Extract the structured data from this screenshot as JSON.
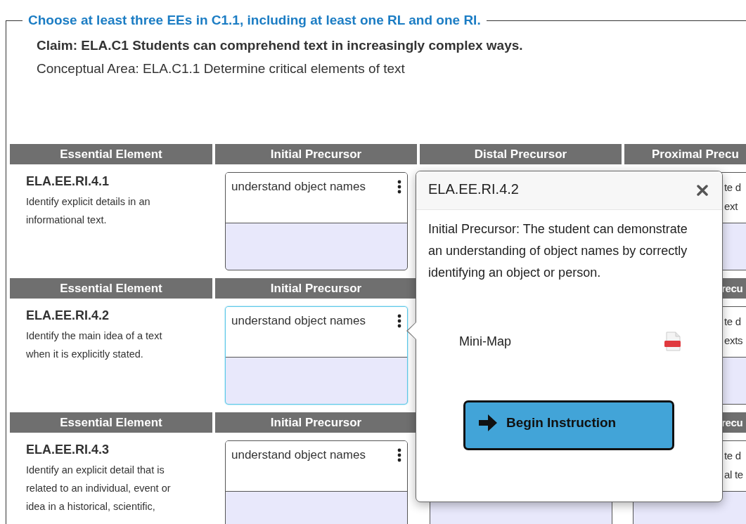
{
  "legend": "Choose at least three EEs in C1.1, including at least one RL and one RI.",
  "claim": "Claim: ELA.C1 Students can comprehend text in increasingly complex ways.",
  "conceptual_area": "Conceptual Area: ELA.C1.1 Determine critical elements of text",
  "sections": [
    {
      "headers": {
        "column_1": "Essential Element",
        "column_2": "Initial Precursor",
        "column_3": "Distal Precursor",
        "column_4": "Proximal Precu"
      },
      "ee_code": "ELA.EE.RI.4.1",
      "ee_description": "Identify explicit details in an informational text.",
      "initial_precursor": {
        "text": "understand object names",
        "selected": false
      },
      "proximal_precursor_fragments": [
        "te d",
        "ext"
      ]
    },
    {
      "headers": {
        "column_1": "Essential Element",
        "column_2": "Initial Precursor",
        "column_4": "recu"
      },
      "ee_code": "ELA.EE.RI.4.2",
      "ee_description": "Identify the main idea of a text when it is explicitly stated.",
      "initial_precursor": {
        "text": "understand object names",
        "selected": true
      },
      "proximal_precursor_fragments": [
        "te d",
        "exts"
      ]
    },
    {
      "headers": {
        "column_1": "Essential Element",
        "column_2": "Initial Precursor",
        "column_4": "recu"
      },
      "ee_code": "ELA.EE.RI.4.3",
      "ee_description": "Identify an explicit detail that is related to an individual, event or idea in a historical, scientific,",
      "initial_precursor": {
        "text": "understand object names",
        "selected": false
      },
      "proximal_precursor_fragments": [
        "te d",
        "al te"
      ]
    }
  ],
  "popover": {
    "title": "ELA.EE.RI.4.2",
    "body": "Initial Precursor: The student can demonstrate an understanding of object names by correctly identifying an object or person.",
    "resource": "Mini-Map",
    "button": "Begin Instruction"
  }
}
